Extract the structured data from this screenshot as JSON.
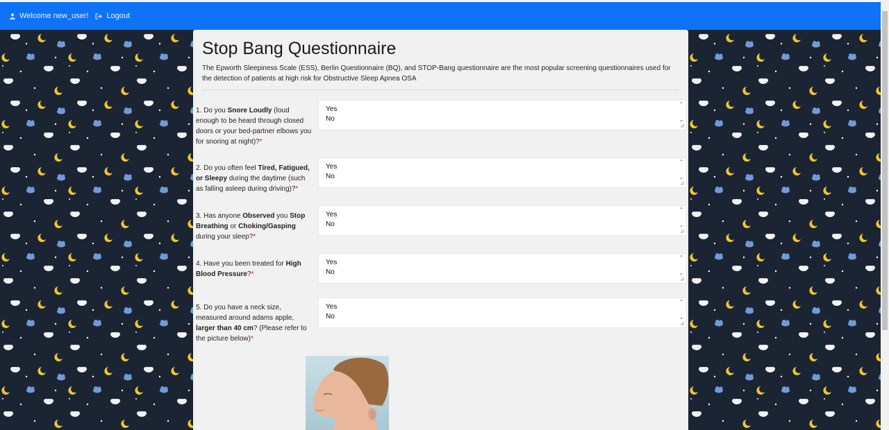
{
  "navbar": {
    "welcome": "Welcome new_user!",
    "logout": "Logout"
  },
  "page": {
    "title": "Stop Bang Questionnaire",
    "intro": "The Epworth Sleepiness Scale (ESS), Berlin Questionnaire (BQ), and STOP-Bang questionnaire are the most popular screening questionnaires used for the detection of patients at high risk for Obstructive Sleep Apnea OSA"
  },
  "questions": [
    {
      "id": "q1",
      "parts": [
        "1. Do you ",
        "Snore Loudly",
        " (loud enough to be heard through closed doors or your bed-partner elbows you for snoring at night)?"
      ],
      "required": "*",
      "options": [
        "Yes",
        "No"
      ]
    },
    {
      "id": "q2",
      "parts": [
        "2. Do you often feel ",
        "Tired, Fatigued, or Sleepy",
        " during the daytime (such as falling asleep during driving)?"
      ],
      "required": "*",
      "options": [
        "Yes",
        "No"
      ]
    },
    {
      "id": "q3",
      "parts": [
        "3. Has anyone ",
        "Observed",
        " you ",
        "Stop Breathing",
        " or ",
        "Choking/Gasping",
        " during your sleep?"
      ],
      "required": "*",
      "options": [
        "Yes",
        "No"
      ]
    },
    {
      "id": "q4",
      "parts": [
        "4. Have you been treated for ",
        "High Blood Pressure",
        "?"
      ],
      "required": "*",
      "options": [
        "Yes",
        "No"
      ]
    },
    {
      "id": "q5",
      "parts": [
        "5. Do you have a neck size, measured around adams apple, ",
        "larger than 40 cm",
        "? (Please refer to the picture below)"
      ],
      "required": "*",
      "options": [
        "Yes",
        "No"
      ]
    }
  ],
  "colors": {
    "navbar": "#0f73f7",
    "background": "#1b2432",
    "card": "#f1f1f1",
    "required": "#d9161b"
  },
  "icons": {
    "welcome": "user-icon",
    "logout": "sign-out-icon",
    "pattern": [
      "sheep-icon",
      "moon-icon",
      "cloud-icon",
      "star-icon"
    ]
  }
}
